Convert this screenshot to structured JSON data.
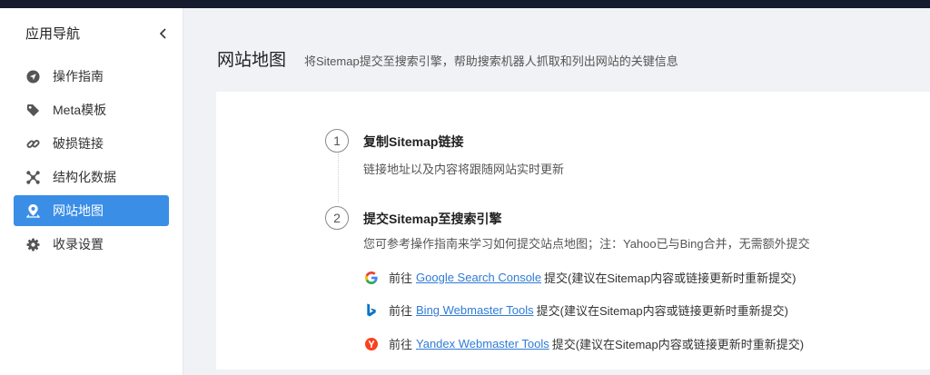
{
  "sidebar": {
    "title": "应用导航",
    "items": [
      {
        "label": "操作指南",
        "icon": "navigation-arrow-icon"
      },
      {
        "label": "Meta模板",
        "icon": "tag-icon"
      },
      {
        "label": "破损链接",
        "icon": "link-icon"
      },
      {
        "label": "结构化数据",
        "icon": "structure-icon"
      },
      {
        "label": "网站地图",
        "icon": "map-pin-icon",
        "active": true
      },
      {
        "label": "收录设置",
        "icon": "gear-icon"
      }
    ]
  },
  "page": {
    "title": "网站地图",
    "description": "将Sitemap提交至搜索引擎，帮助搜索机器人抓取和列出网站的关键信息"
  },
  "steps": [
    {
      "num": "1",
      "title": "复制Sitemap链接",
      "desc": "链接地址以及内容将跟随网站实时更新"
    },
    {
      "num": "2",
      "title": "提交Sitemap至搜索引擎",
      "desc": "您可参考操作指南来学习如何提交站点地图；注：Yahoo已与Bing合并，无需额外提交"
    }
  ],
  "engines": [
    {
      "prefix": "前往",
      "link": "Google Search Console",
      "suffix": "提交(建议在Sitemap内容或链接更新时重新提交)",
      "icon": "google-icon"
    },
    {
      "prefix": "前往",
      "link": "Bing Webmaster Tools",
      "suffix": "提交(建议在Sitemap内容或链接更新时重新提交)",
      "icon": "bing-icon"
    },
    {
      "prefix": "前往",
      "link": "Yandex Webmaster Tools",
      "suffix": "提交(建议在Sitemap内容或链接更新时重新提交)",
      "icon": "yandex-icon"
    }
  ],
  "colors": {
    "topbar": "#161b2e",
    "accent": "#3a8ee6",
    "link": "#2f7bd6",
    "google_blue": "#4285f4",
    "google_red": "#ea4335",
    "google_yellow": "#fbbc05",
    "google_green": "#34a853",
    "bing": "#0a73c6",
    "yandex": "#fc3f1d"
  }
}
